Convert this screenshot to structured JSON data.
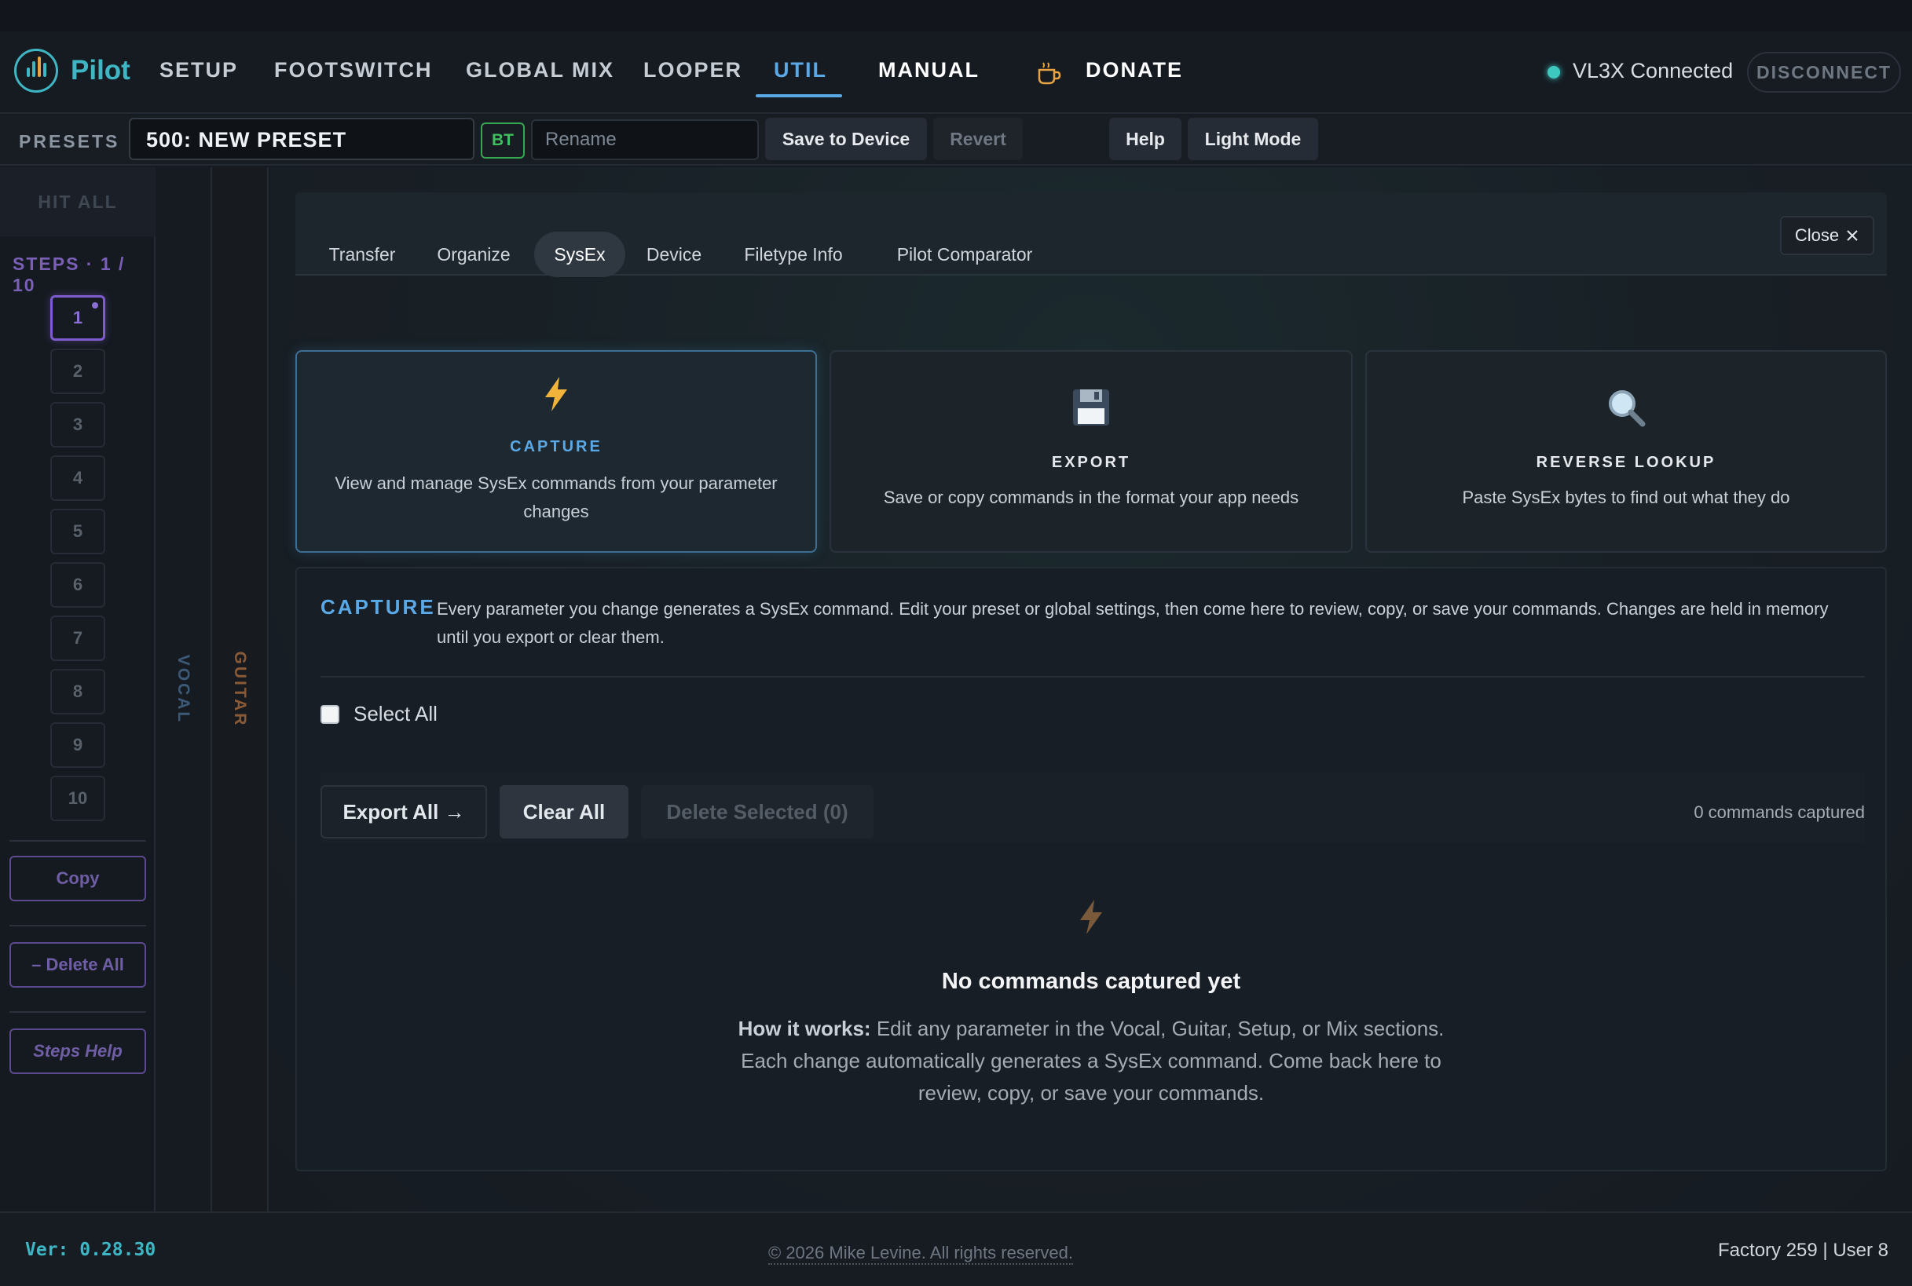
{
  "app": {
    "logo_text": "Pilot"
  },
  "nav": {
    "items": [
      "SETUP",
      "FOOTSWITCH",
      "GLOBAL MIX",
      "LOOPER",
      "UTIL",
      "MANUAL"
    ],
    "donate": "DONATE",
    "status": "VL3X Connected",
    "disconnect": "DISCONNECT",
    "status_color": "#3ec9c0"
  },
  "presets": {
    "label": "PRESETS",
    "current": "500: NEW PRESET",
    "bt_badge": "BT",
    "rename_placeholder": "Rename",
    "save": "Save to Device",
    "revert": "Revert",
    "help": "Help",
    "light_mode": "Light Mode"
  },
  "steps": {
    "hit_all": "HIT ALL",
    "label": "STEPS · 1 / 10",
    "numbers": [
      "1",
      "2",
      "3",
      "4",
      "5",
      "6",
      "7",
      "8",
      "9",
      "10"
    ],
    "copy": "Copy",
    "delete_all": "– Delete All",
    "help": "Steps Help"
  },
  "columns": {
    "vocal": "VOCAL",
    "guitar": "GUITAR"
  },
  "util": {
    "tabs": [
      "Transfer",
      "Organize",
      "SysEx",
      "Device",
      "Filetype Info",
      "Pilot Comparator"
    ],
    "active_tab": "SysEx",
    "close": "Close"
  },
  "cards": [
    {
      "icon": "lightning-icon",
      "title": "CAPTURE",
      "desc": "View and manage SysEx commands from your parameter changes"
    },
    {
      "icon": "floppy-disk-icon",
      "title": "EXPORT",
      "desc": "Save or copy commands in the format your app needs"
    },
    {
      "icon": "magnifier-icon",
      "title": "REVERSE LOOKUP",
      "desc": "Paste SysEx bytes to find out what they do"
    }
  ],
  "capture": {
    "heading": "CAPTURE",
    "description": "Every parameter you change generates a SysEx command. Edit your preset or global settings, then come here to review, copy, or save your commands. Changes are held in memory until you export or clear them.",
    "select_all": "Select All",
    "export_all": "Export All →",
    "clear_all": "Clear All",
    "delete_selected": "Delete Selected (0)",
    "count": "0 commands captured",
    "empty_title": "No commands captured yet",
    "empty_lead": "How it works:",
    "empty_body": " Edit any parameter in the Vocal, Guitar, Setup, or Mix sections. Each change automatically generates a SysEx command. Come back here to review, copy, or save your commands."
  },
  "footer": {
    "version": "Ver: 0.28.30",
    "copyright": "© 2026 Mike Levine. All rights reserved.",
    "counts": "Factory 259 | User 8"
  },
  "colors": {
    "accent": "#5aa9e6",
    "brand": "#3fb6c4",
    "steps": "#7d5ccf"
  }
}
